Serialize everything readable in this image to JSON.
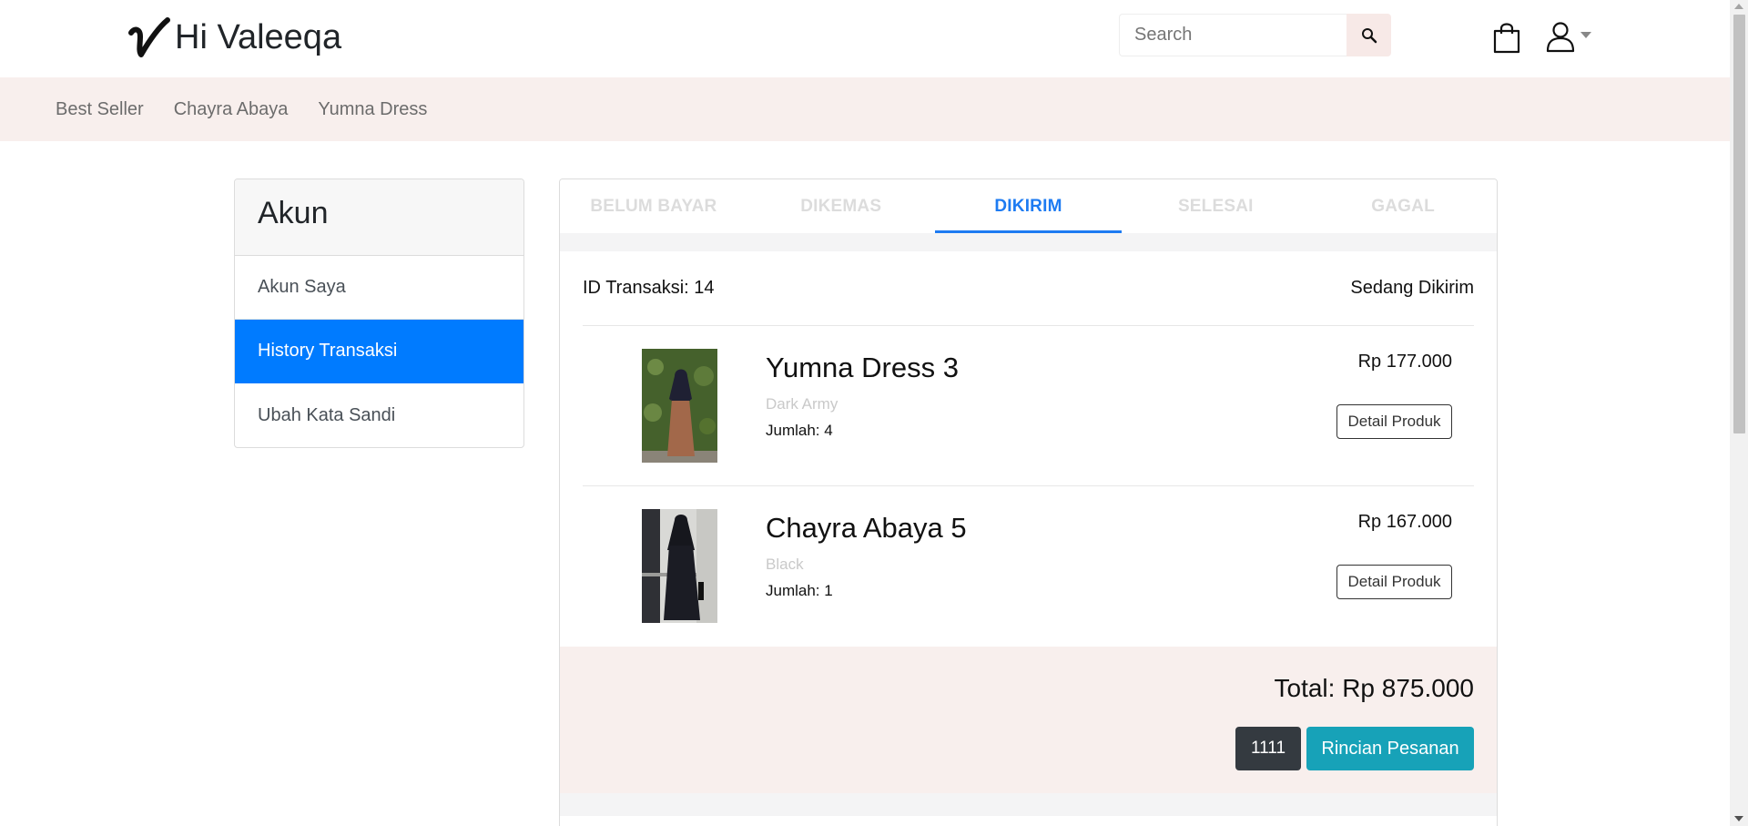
{
  "header": {
    "brand_text": "Hi Valeeqa",
    "search_placeholder": "Search",
    "icons": {
      "logo": "v-logo-icon",
      "search": "search-icon",
      "cart": "shopping-bag-icon",
      "user": "user-icon",
      "dropdown": "caret-down-icon"
    }
  },
  "category_nav": {
    "items": [
      "Best Seller",
      "Chayra Abaya",
      "Yumna Dress"
    ]
  },
  "sidebar": {
    "title": "Akun",
    "items": [
      {
        "label": "Akun Saya",
        "active": false
      },
      {
        "label": "History Transaksi",
        "active": true
      },
      {
        "label": "Ubah Kata Sandi",
        "active": false
      }
    ]
  },
  "tabs": [
    {
      "label": "BELUM BAYAR",
      "active": false
    },
    {
      "label": "DIKEMAS",
      "active": false
    },
    {
      "label": "DIKIRIM",
      "active": true
    },
    {
      "label": "SELESAI",
      "active": false
    },
    {
      "label": "GAGAL",
      "active": false
    }
  ],
  "order": {
    "transaction_id": "ID Transaksi: 14",
    "status": "Sedang Dikirim",
    "items": [
      {
        "name": "Yumna Dress 3",
        "variant": "Dark Army",
        "quantity": "Jumlah: 4",
        "price": "Rp 177.000",
        "detail_label": "Detail Produk"
      },
      {
        "name": "Chayra Abaya 5",
        "variant": "Black",
        "quantity": "Jumlah: 1",
        "price": "Rp 167.000",
        "detail_label": "Detail Produk"
      }
    ],
    "total": "Total: Rp 875.000",
    "code_button": "1111",
    "detail_button": "Rincian Pesanan"
  },
  "colors": {
    "accent_blue": "#007bff",
    "tab_active": "#1d7bf2",
    "info_button": "#17a2b8",
    "dark_button": "#343a40",
    "pink_band": "#f8efed"
  }
}
